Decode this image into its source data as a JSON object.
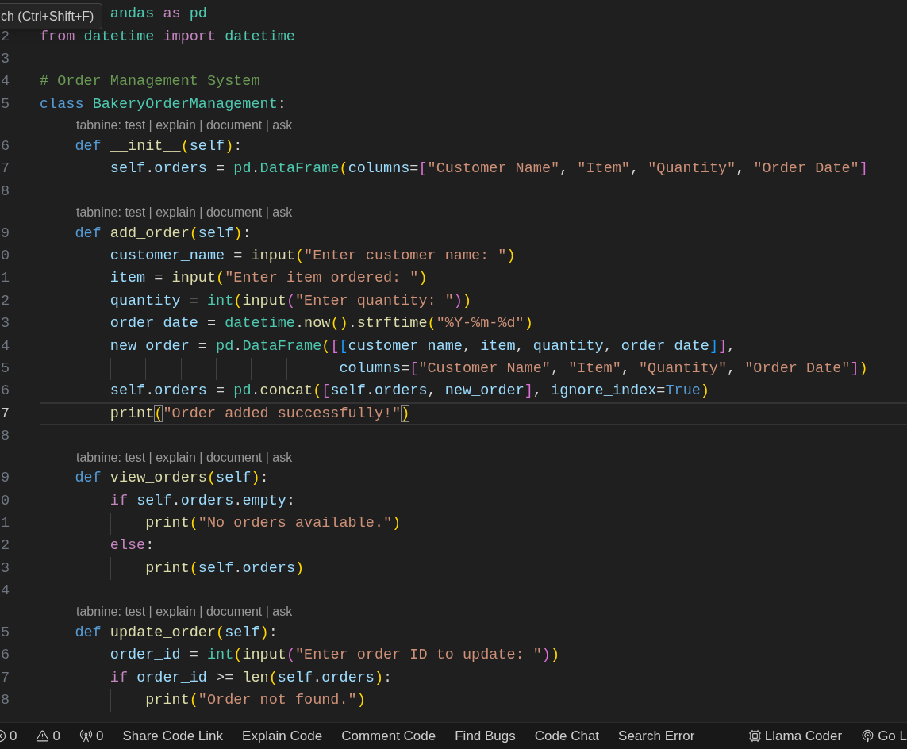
{
  "tooltip": {
    "text": "ch (Ctrl+Shift+F)"
  },
  "lines": [
    {
      "kind": "code",
      "segments": [
        {
          "kind": "type",
          "text": "        andas"
        },
        {
          "kind": "kw",
          "text": " as "
        },
        {
          "kind": "type",
          "text": "pd"
        }
      ]
    },
    {
      "kind": "code",
      "number": "2",
      "segments": [
        {
          "kind": "kw",
          "text": "from "
        },
        {
          "kind": "type",
          "text": "datetime "
        },
        {
          "kind": "kw",
          "text": "import "
        },
        {
          "kind": "type",
          "text": "datetime"
        }
      ]
    },
    {
      "kind": "code",
      "number": "3"
    },
    {
      "kind": "code",
      "number": "4",
      "segments": [
        {
          "kind": "comment",
          "text": "# Order Management System"
        }
      ]
    },
    {
      "kind": "code",
      "number": "5",
      "segments": [
        {
          "kind": "storage",
          "text": "class "
        },
        {
          "kind": "type",
          "text": "BakeryOrderManagement"
        },
        {
          "kind": "op",
          "text": ":"
        }
      ]
    },
    {
      "kind": "codelens",
      "text": "tabnine: test | explain | document | ask"
    },
    {
      "kind": "code",
      "number": "6",
      "segments": [
        {
          "kind": "storage",
          "text": "    def "
        },
        {
          "kind": "fn",
          "text": "__init__"
        },
        {
          "kind": "b1",
          "text": "("
        },
        {
          "kind": "var",
          "text": "self"
        },
        {
          "kind": "b1",
          "text": ")"
        },
        {
          "kind": "op",
          "text": ":"
        }
      ]
    },
    {
      "kind": "code",
      "number": "7",
      "segments": [
        {
          "kind": "var",
          "text": "        self"
        },
        {
          "kind": "op",
          "text": "."
        },
        {
          "kind": "var",
          "text": "orders"
        },
        {
          "kind": "op",
          "text": " = "
        },
        {
          "kind": "type",
          "text": "pd"
        },
        {
          "kind": "op",
          "text": "."
        },
        {
          "kind": "type",
          "text": "DataFrame"
        },
        {
          "kind": "b1",
          "text": "("
        },
        {
          "kind": "var",
          "text": "columns"
        },
        {
          "kind": "op",
          "text": "="
        },
        {
          "kind": "b2",
          "text": "["
        },
        {
          "kind": "str",
          "text": "\"Customer Name\""
        },
        {
          "kind": "op",
          "text": ", "
        },
        {
          "kind": "str",
          "text": "\"Item\""
        },
        {
          "kind": "op",
          "text": ", "
        },
        {
          "kind": "str",
          "text": "\"Quantity\""
        },
        {
          "kind": "op",
          "text": ", "
        },
        {
          "kind": "str",
          "text": "\"Order Date\""
        },
        {
          "kind": "b2",
          "text": "]"
        }
      ]
    },
    {
      "kind": "code",
      "number": "8"
    },
    {
      "kind": "codelens",
      "text": "tabnine: test | explain | document | ask"
    },
    {
      "kind": "code",
      "number": "9",
      "segments": [
        {
          "kind": "storage",
          "text": "    def "
        },
        {
          "kind": "fn",
          "text": "add_order"
        },
        {
          "kind": "b1",
          "text": "("
        },
        {
          "kind": "var",
          "text": "self"
        },
        {
          "kind": "b1",
          "text": ")"
        },
        {
          "kind": "op",
          "text": ":"
        }
      ]
    },
    {
      "kind": "code",
      "number": "0",
      "segments": [
        {
          "kind": "var",
          "text": "        customer_name"
        },
        {
          "kind": "op",
          "text": " = "
        },
        {
          "kind": "fn",
          "text": "input"
        },
        {
          "kind": "b1",
          "text": "("
        },
        {
          "kind": "str",
          "text": "\"Enter customer name: \""
        },
        {
          "kind": "b1",
          "text": ")"
        }
      ]
    },
    {
      "kind": "code",
      "number": "1",
      "segments": [
        {
          "kind": "var",
          "text": "        item"
        },
        {
          "kind": "op",
          "text": " = "
        },
        {
          "kind": "fn",
          "text": "input"
        },
        {
          "kind": "b1",
          "text": "("
        },
        {
          "kind": "str",
          "text": "\"Enter item ordered: \""
        },
        {
          "kind": "b1",
          "text": ")"
        }
      ]
    },
    {
      "kind": "code",
      "number": "2",
      "segments": [
        {
          "kind": "var",
          "text": "        quantity"
        },
        {
          "kind": "op",
          "text": " = "
        },
        {
          "kind": "type",
          "text": "int"
        },
        {
          "kind": "b1",
          "text": "("
        },
        {
          "kind": "fn",
          "text": "input"
        },
        {
          "kind": "b2",
          "text": "("
        },
        {
          "kind": "str",
          "text": "\"Enter quantity: \""
        },
        {
          "kind": "b2",
          "text": ")"
        },
        {
          "kind": "b1",
          "text": ")"
        }
      ]
    },
    {
      "kind": "code",
      "number": "3",
      "segments": [
        {
          "kind": "var",
          "text": "        order_date"
        },
        {
          "kind": "op",
          "text": " = "
        },
        {
          "kind": "type",
          "text": "datetime"
        },
        {
          "kind": "op",
          "text": "."
        },
        {
          "kind": "fn",
          "text": "now"
        },
        {
          "kind": "b1",
          "text": "()"
        },
        {
          "kind": "op",
          "text": "."
        },
        {
          "kind": "fn",
          "text": "strftime"
        },
        {
          "kind": "b1",
          "text": "("
        },
        {
          "kind": "str",
          "text": "\"%Y-%m-%d\""
        },
        {
          "kind": "b1",
          "text": ")"
        }
      ]
    },
    {
      "kind": "code",
      "number": "4",
      "segments": [
        {
          "kind": "var",
          "text": "        new_order"
        },
        {
          "kind": "op",
          "text": " = "
        },
        {
          "kind": "type",
          "text": "pd"
        },
        {
          "kind": "op",
          "text": "."
        },
        {
          "kind": "type",
          "text": "DataFrame"
        },
        {
          "kind": "b1",
          "text": "("
        },
        {
          "kind": "b2",
          "text": "["
        },
        {
          "kind": "b3",
          "text": "["
        },
        {
          "kind": "var",
          "text": "customer_name"
        },
        {
          "kind": "op",
          "text": ", "
        },
        {
          "kind": "var",
          "text": "item"
        },
        {
          "kind": "op",
          "text": ", "
        },
        {
          "kind": "var",
          "text": "quantity"
        },
        {
          "kind": "op",
          "text": ", "
        },
        {
          "kind": "var",
          "text": "order_date"
        },
        {
          "kind": "b3",
          "text": "]"
        },
        {
          "kind": "b2",
          "text": "]"
        },
        {
          "kind": "op",
          "text": ","
        }
      ]
    },
    {
      "kind": "code",
      "number": "5",
      "segments": [
        {
          "kind": "var",
          "text": "                                  columns"
        },
        {
          "kind": "op",
          "text": "="
        },
        {
          "kind": "b2",
          "text": "["
        },
        {
          "kind": "str",
          "text": "\"Customer Name\""
        },
        {
          "kind": "op",
          "text": ", "
        },
        {
          "kind": "str",
          "text": "\"Item\""
        },
        {
          "kind": "op",
          "text": ", "
        },
        {
          "kind": "str",
          "text": "\"Quantity\""
        },
        {
          "kind": "op",
          "text": ", "
        },
        {
          "kind": "str",
          "text": "\"Order Date\""
        },
        {
          "kind": "b2",
          "text": "]"
        },
        {
          "kind": "b1",
          "text": ")"
        }
      ]
    },
    {
      "kind": "code",
      "number": "6",
      "segments": [
        {
          "kind": "var",
          "text": "        self"
        },
        {
          "kind": "op",
          "text": "."
        },
        {
          "kind": "var",
          "text": "orders"
        },
        {
          "kind": "op",
          "text": " = "
        },
        {
          "kind": "type",
          "text": "pd"
        },
        {
          "kind": "op",
          "text": "."
        },
        {
          "kind": "fn",
          "text": "concat"
        },
        {
          "kind": "b1",
          "text": "("
        },
        {
          "kind": "b2",
          "text": "["
        },
        {
          "kind": "var",
          "text": "self"
        },
        {
          "kind": "op",
          "text": "."
        },
        {
          "kind": "var",
          "text": "orders"
        },
        {
          "kind": "op",
          "text": ", "
        },
        {
          "kind": "var",
          "text": "new_order"
        },
        {
          "kind": "b2",
          "text": "]"
        },
        {
          "kind": "op",
          "text": ", "
        },
        {
          "kind": "var",
          "text": "ignore_index"
        },
        {
          "kind": "op",
          "text": "="
        },
        {
          "kind": "storage",
          "text": "True"
        },
        {
          "kind": "b1",
          "text": ")"
        }
      ]
    },
    {
      "kind": "code",
      "number": "7",
      "current": true,
      "segments": [
        {
          "kind": "fn",
          "text": "        print"
        },
        {
          "kind": "matched",
          "text": "("
        },
        {
          "kind": "str",
          "text": "\"Order added successfully!\""
        },
        {
          "kind": "matched",
          "text": ")"
        }
      ]
    },
    {
      "kind": "code",
      "number": "8"
    },
    {
      "kind": "codelens",
      "text": "tabnine: test | explain | document | ask"
    },
    {
      "kind": "code",
      "number": "9",
      "segments": [
        {
          "kind": "storage",
          "text": "    def "
        },
        {
          "kind": "fn",
          "text": "view_orders"
        },
        {
          "kind": "b1",
          "text": "("
        },
        {
          "kind": "var",
          "text": "self"
        },
        {
          "kind": "b1",
          "text": ")"
        },
        {
          "kind": "op",
          "text": ":"
        }
      ]
    },
    {
      "kind": "code",
      "number": "0",
      "segments": [
        {
          "kind": "kw",
          "text": "        if "
        },
        {
          "kind": "var",
          "text": "self"
        },
        {
          "kind": "op",
          "text": "."
        },
        {
          "kind": "var",
          "text": "orders"
        },
        {
          "kind": "op",
          "text": "."
        },
        {
          "kind": "var",
          "text": "empty"
        },
        {
          "kind": "op",
          "text": ":"
        }
      ]
    },
    {
      "kind": "code",
      "number": "1",
      "segments": [
        {
          "kind": "fn",
          "text": "            print"
        },
        {
          "kind": "b1",
          "text": "("
        },
        {
          "kind": "str",
          "text": "\"No orders available.\""
        },
        {
          "kind": "b1",
          "text": ")"
        }
      ]
    },
    {
      "kind": "code",
      "number": "2",
      "segments": [
        {
          "kind": "kw",
          "text": "        else"
        },
        {
          "kind": "op",
          "text": ":"
        }
      ]
    },
    {
      "kind": "code",
      "number": "3",
      "segments": [
        {
          "kind": "fn",
          "text": "            print"
        },
        {
          "kind": "b1",
          "text": "("
        },
        {
          "kind": "var",
          "text": "self"
        },
        {
          "kind": "op",
          "text": "."
        },
        {
          "kind": "var",
          "text": "orders"
        },
        {
          "kind": "b1",
          "text": ")"
        }
      ]
    },
    {
      "kind": "code",
      "number": "4"
    },
    {
      "kind": "codelens",
      "text": "tabnine: test | explain | document | ask"
    },
    {
      "kind": "code",
      "number": "5",
      "segments": [
        {
          "kind": "storage",
          "text": "    def "
        },
        {
          "kind": "fn",
          "text": "update_order"
        },
        {
          "kind": "b1",
          "text": "("
        },
        {
          "kind": "var",
          "text": "self"
        },
        {
          "kind": "b1",
          "text": ")"
        },
        {
          "kind": "op",
          "text": ":"
        }
      ]
    },
    {
      "kind": "code",
      "number": "6",
      "segments": [
        {
          "kind": "var",
          "text": "        order_id"
        },
        {
          "kind": "op",
          "text": " = "
        },
        {
          "kind": "type",
          "text": "int"
        },
        {
          "kind": "b1",
          "text": "("
        },
        {
          "kind": "fn",
          "text": "input"
        },
        {
          "kind": "b2",
          "text": "("
        },
        {
          "kind": "str",
          "text": "\"Enter order ID to update: \""
        },
        {
          "kind": "b2",
          "text": ")"
        },
        {
          "kind": "b1",
          "text": ")"
        }
      ]
    },
    {
      "kind": "code",
      "number": "7",
      "segments": [
        {
          "kind": "kw",
          "text": "        if "
        },
        {
          "kind": "var",
          "text": "order_id"
        },
        {
          "kind": "op",
          "text": " >= "
        },
        {
          "kind": "fn",
          "text": "len"
        },
        {
          "kind": "b1",
          "text": "("
        },
        {
          "kind": "var",
          "text": "self"
        },
        {
          "kind": "op",
          "text": "."
        },
        {
          "kind": "var",
          "text": "orders"
        },
        {
          "kind": "b1",
          "text": ")"
        },
        {
          "kind": "op",
          "text": ":"
        }
      ]
    },
    {
      "kind": "code",
      "number": "8",
      "segments": [
        {
          "kind": "fn",
          "text": "            print"
        },
        {
          "kind": "b1",
          "text": "("
        },
        {
          "kind": "str",
          "text": "\"Order not found.\""
        },
        {
          "kind": "b1",
          "text": ")"
        }
      ]
    }
  ],
  "status_bar": {
    "left": [
      {
        "kind": "error",
        "text": "0"
      },
      {
        "kind": "warning",
        "text": "0"
      },
      {
        "kind": "broadcast",
        "text": "0"
      },
      {
        "kind": "text",
        "text": "Share Code Link"
      },
      {
        "kind": "text",
        "text": "Explain Code"
      },
      {
        "kind": "text",
        "text": "Comment Code"
      },
      {
        "kind": "text",
        "text": "Find Bugs"
      },
      {
        "kind": "text",
        "text": "Code Chat"
      },
      {
        "kind": "text",
        "text": "Search Error"
      }
    ],
    "right": [
      {
        "kind": "chip",
        "text": "Llama Coder"
      },
      {
        "kind": "antenna",
        "text": "Go L"
      }
    ]
  }
}
